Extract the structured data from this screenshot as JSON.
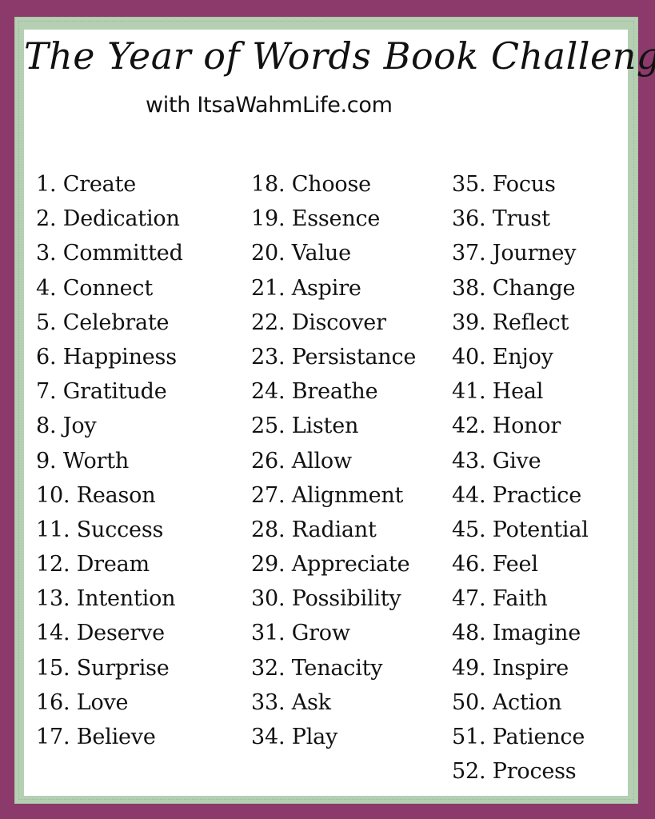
{
  "title": "The Year of Words Book Challenge",
  "subtitle": "with ItsaWahmLife.com",
  "colors": {
    "outer_border": "#8b3a6b",
    "inner_border": "#b5cfb3",
    "background": "#ffffff",
    "text": "#111111"
  },
  "columns": [
    {
      "items": [
        "1. Create",
        "2. Dedication",
        "3. Committed",
        "4. Connect",
        "5. Celebrate",
        "6. Happiness",
        "7. Gratitude",
        "8. Joy",
        "9. Worth",
        "10. Reason",
        "11. Success",
        "12. Dream",
        "13. Intention",
        "14. Deserve",
        "15. Surprise",
        "16. Love",
        "17. Believe"
      ]
    },
    {
      "items": [
        "18. Choose",
        "19. Essence",
        "20. Value",
        "21. Aspire",
        "22. Discover",
        "23. Persistance",
        "24. Breathe",
        "25. Listen",
        "26. Allow",
        "27. Alignment",
        "28. Radiant",
        "29. Appreciate",
        "30. Possibility",
        "31. Grow",
        "32. Tenacity",
        "33. Ask",
        "34. Play"
      ]
    },
    {
      "items": [
        "35. Focus",
        "36. Trust",
        "37. Journey",
        "38. Change",
        "39. Reflect",
        "40. Enjoy",
        "41. Heal",
        "42. Honor",
        "43. Give",
        "44. Practice",
        "45. Potential",
        "46. Feel",
        "47. Faith",
        "48. Imagine",
        "49. Inspire",
        "50. Action",
        "51. Patience",
        "52. Process"
      ]
    }
  ]
}
